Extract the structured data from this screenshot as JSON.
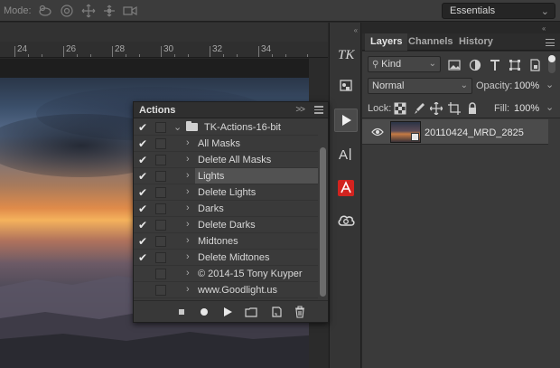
{
  "options_bar": {
    "mode_label": "Mode:",
    "mode_icons": [
      "orbit-3d-icon",
      "roll-3d-icon",
      "pan-3d-icon",
      "slide-3d-icon",
      "video-camera-icon"
    ],
    "workspace": "Essentials"
  },
  "ruler": {
    "labels": [
      "24",
      "26",
      "28",
      "30",
      "32",
      "34"
    ]
  },
  "icon_strip": [
    "tk-panel-icon",
    "info-panel-icon",
    "actions-play-icon",
    "character-panel-icon",
    "extension-icon",
    "creative-cloud-icon"
  ],
  "actions_panel": {
    "title": "Actions",
    "collapse_glyph": ">>",
    "set_name": "TK-Actions-16-bit",
    "items": [
      {
        "label": "All Masks",
        "checked": true,
        "selected": false
      },
      {
        "label": "Delete All Masks",
        "checked": true,
        "selected": false
      },
      {
        "label": "Lights",
        "checked": true,
        "selected": true
      },
      {
        "label": "Delete Lights",
        "checked": true,
        "selected": false
      },
      {
        "label": "Darks",
        "checked": true,
        "selected": false
      },
      {
        "label": "Delete Darks",
        "checked": true,
        "selected": false
      },
      {
        "label": "Midtones",
        "checked": true,
        "selected": false
      },
      {
        "label": "Delete Midtones",
        "checked": true,
        "selected": false
      },
      {
        "label": "© 2014-15 Tony Kuyper",
        "checked": false,
        "selected": false
      },
      {
        "label": "www.Goodlight.us",
        "checked": false,
        "selected": false
      }
    ],
    "footer_icons": [
      "stop-icon",
      "record-icon",
      "play-icon",
      "new-set-icon",
      "new-action-icon",
      "delete-icon"
    ]
  },
  "layers_panel": {
    "tabs": [
      {
        "label": "Layers",
        "active": true
      },
      {
        "label": "Channels",
        "active": false
      },
      {
        "label": "History",
        "active": false
      }
    ],
    "filter_kind": "Kind",
    "filter_icons": [
      "pixel-filter-icon",
      "adjustment-filter-icon",
      "type-filter-icon",
      "shape-filter-icon",
      "smart-object-filter-icon"
    ],
    "blend_mode": "Normal",
    "opacity_label": "Opacity:",
    "opacity_value": "100%",
    "lock_label": "Lock:",
    "lock_icons": [
      "lock-pixels-icon",
      "lock-paint-icon",
      "lock-position-icon",
      "lock-artboard-icon",
      "lock-all-icon"
    ],
    "fill_label": "Fill:",
    "fill_value": "100%",
    "layers": [
      {
        "name": "20110424_MRD_2825",
        "visible": true
      }
    ]
  },
  "colors": {
    "panel_bg": "#3a3a3a",
    "selected_row": "#525252",
    "accent_sunset": "#e08b4a"
  }
}
